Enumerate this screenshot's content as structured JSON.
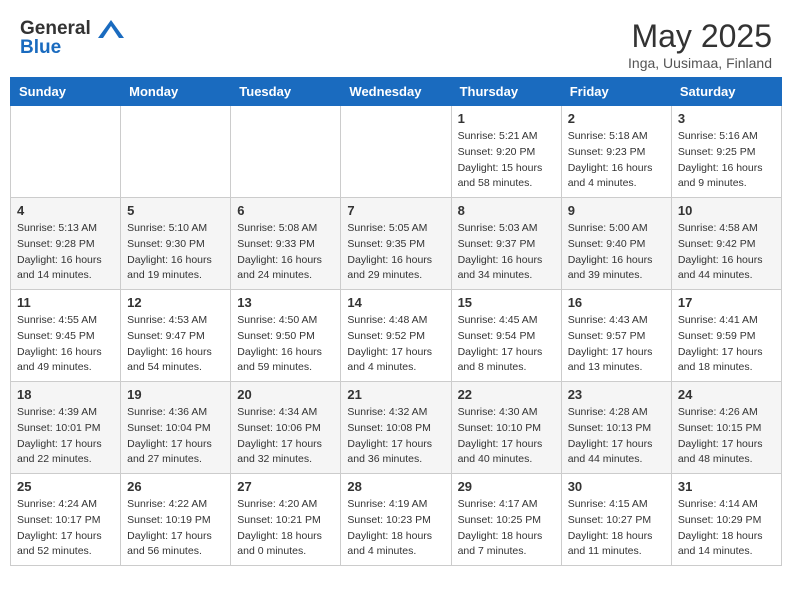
{
  "header": {
    "logo_line1": "General",
    "logo_line2": "Blue",
    "month": "May 2025",
    "location": "Inga, Uusimaa, Finland"
  },
  "weekdays": [
    "Sunday",
    "Monday",
    "Tuesday",
    "Wednesday",
    "Thursday",
    "Friday",
    "Saturday"
  ],
  "weeks": [
    [
      {
        "day": "",
        "info": ""
      },
      {
        "day": "",
        "info": ""
      },
      {
        "day": "",
        "info": ""
      },
      {
        "day": "",
        "info": ""
      },
      {
        "day": "1",
        "info": "Sunrise: 5:21 AM\nSunset: 9:20 PM\nDaylight: 15 hours\nand 58 minutes."
      },
      {
        "day": "2",
        "info": "Sunrise: 5:18 AM\nSunset: 9:23 PM\nDaylight: 16 hours\nand 4 minutes."
      },
      {
        "day": "3",
        "info": "Sunrise: 5:16 AM\nSunset: 9:25 PM\nDaylight: 16 hours\nand 9 minutes."
      }
    ],
    [
      {
        "day": "4",
        "info": "Sunrise: 5:13 AM\nSunset: 9:28 PM\nDaylight: 16 hours\nand 14 minutes."
      },
      {
        "day": "5",
        "info": "Sunrise: 5:10 AM\nSunset: 9:30 PM\nDaylight: 16 hours\nand 19 minutes."
      },
      {
        "day": "6",
        "info": "Sunrise: 5:08 AM\nSunset: 9:33 PM\nDaylight: 16 hours\nand 24 minutes."
      },
      {
        "day": "7",
        "info": "Sunrise: 5:05 AM\nSunset: 9:35 PM\nDaylight: 16 hours\nand 29 minutes."
      },
      {
        "day": "8",
        "info": "Sunrise: 5:03 AM\nSunset: 9:37 PM\nDaylight: 16 hours\nand 34 minutes."
      },
      {
        "day": "9",
        "info": "Sunrise: 5:00 AM\nSunset: 9:40 PM\nDaylight: 16 hours\nand 39 minutes."
      },
      {
        "day": "10",
        "info": "Sunrise: 4:58 AM\nSunset: 9:42 PM\nDaylight: 16 hours\nand 44 minutes."
      }
    ],
    [
      {
        "day": "11",
        "info": "Sunrise: 4:55 AM\nSunset: 9:45 PM\nDaylight: 16 hours\nand 49 minutes."
      },
      {
        "day": "12",
        "info": "Sunrise: 4:53 AM\nSunset: 9:47 PM\nDaylight: 16 hours\nand 54 minutes."
      },
      {
        "day": "13",
        "info": "Sunrise: 4:50 AM\nSunset: 9:50 PM\nDaylight: 16 hours\nand 59 minutes."
      },
      {
        "day": "14",
        "info": "Sunrise: 4:48 AM\nSunset: 9:52 PM\nDaylight: 17 hours\nand 4 minutes."
      },
      {
        "day": "15",
        "info": "Sunrise: 4:45 AM\nSunset: 9:54 PM\nDaylight: 17 hours\nand 8 minutes."
      },
      {
        "day": "16",
        "info": "Sunrise: 4:43 AM\nSunset: 9:57 PM\nDaylight: 17 hours\nand 13 minutes."
      },
      {
        "day": "17",
        "info": "Sunrise: 4:41 AM\nSunset: 9:59 PM\nDaylight: 17 hours\nand 18 minutes."
      }
    ],
    [
      {
        "day": "18",
        "info": "Sunrise: 4:39 AM\nSunset: 10:01 PM\nDaylight: 17 hours\nand 22 minutes."
      },
      {
        "day": "19",
        "info": "Sunrise: 4:36 AM\nSunset: 10:04 PM\nDaylight: 17 hours\nand 27 minutes."
      },
      {
        "day": "20",
        "info": "Sunrise: 4:34 AM\nSunset: 10:06 PM\nDaylight: 17 hours\nand 32 minutes."
      },
      {
        "day": "21",
        "info": "Sunrise: 4:32 AM\nSunset: 10:08 PM\nDaylight: 17 hours\nand 36 minutes."
      },
      {
        "day": "22",
        "info": "Sunrise: 4:30 AM\nSunset: 10:10 PM\nDaylight: 17 hours\nand 40 minutes."
      },
      {
        "day": "23",
        "info": "Sunrise: 4:28 AM\nSunset: 10:13 PM\nDaylight: 17 hours\nand 44 minutes."
      },
      {
        "day": "24",
        "info": "Sunrise: 4:26 AM\nSunset: 10:15 PM\nDaylight: 17 hours\nand 48 minutes."
      }
    ],
    [
      {
        "day": "25",
        "info": "Sunrise: 4:24 AM\nSunset: 10:17 PM\nDaylight: 17 hours\nand 52 minutes."
      },
      {
        "day": "26",
        "info": "Sunrise: 4:22 AM\nSunset: 10:19 PM\nDaylight: 17 hours\nand 56 minutes."
      },
      {
        "day": "27",
        "info": "Sunrise: 4:20 AM\nSunset: 10:21 PM\nDaylight: 18 hours\nand 0 minutes."
      },
      {
        "day": "28",
        "info": "Sunrise: 4:19 AM\nSunset: 10:23 PM\nDaylight: 18 hours\nand 4 minutes."
      },
      {
        "day": "29",
        "info": "Sunrise: 4:17 AM\nSunset: 10:25 PM\nDaylight: 18 hours\nand 7 minutes."
      },
      {
        "day": "30",
        "info": "Sunrise: 4:15 AM\nSunset: 10:27 PM\nDaylight: 18 hours\nand 11 minutes."
      },
      {
        "day": "31",
        "info": "Sunrise: 4:14 AM\nSunset: 10:29 PM\nDaylight: 18 hours\nand 14 minutes."
      }
    ]
  ]
}
